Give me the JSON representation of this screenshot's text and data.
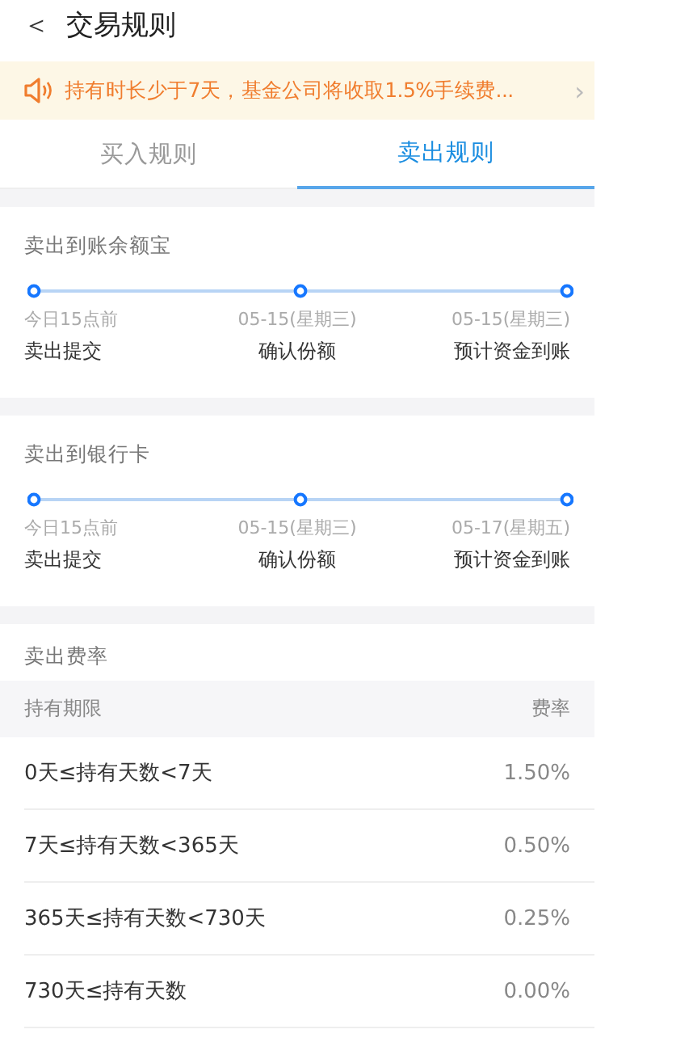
{
  "header": {
    "back": "＜",
    "title": "交易规则"
  },
  "notice": {
    "text": "持有时长少于7天，基金公司将收取1.5%手续费...",
    "arrow": "›"
  },
  "tabs": [
    {
      "label": "买入规则",
      "selected": false
    },
    {
      "label": "卖出规则",
      "selected": true
    }
  ],
  "timelines": [
    {
      "title": "卖出到账余额宝",
      "steps": [
        {
          "time": "今日15点前",
          "label": "卖出提交"
        },
        {
          "time": "05-15(星期三)",
          "label": "确认份额"
        },
        {
          "time": "05-15(星期三)",
          "label": "预计资金到账"
        }
      ]
    },
    {
      "title": "卖出到银行卡",
      "steps": [
        {
          "time": "今日15点前",
          "label": "卖出提交"
        },
        {
          "time": "05-15(星期三)",
          "label": "确认份额"
        },
        {
          "time": "05-17(星期五)",
          "label": "预计资金到账"
        }
      ]
    }
  ],
  "fees": {
    "title": "卖出费率",
    "columns": [
      "持有期限",
      "费率"
    ],
    "rows": [
      [
        "0天≤持有天数<7天",
        "1.50%"
      ],
      [
        "7天≤持有天数<365天",
        "0.50%"
      ],
      [
        "365天≤持有天数<730天",
        "0.25%"
      ],
      [
        "730天≤持有天数",
        "0.00%"
      ]
    ]
  }
}
